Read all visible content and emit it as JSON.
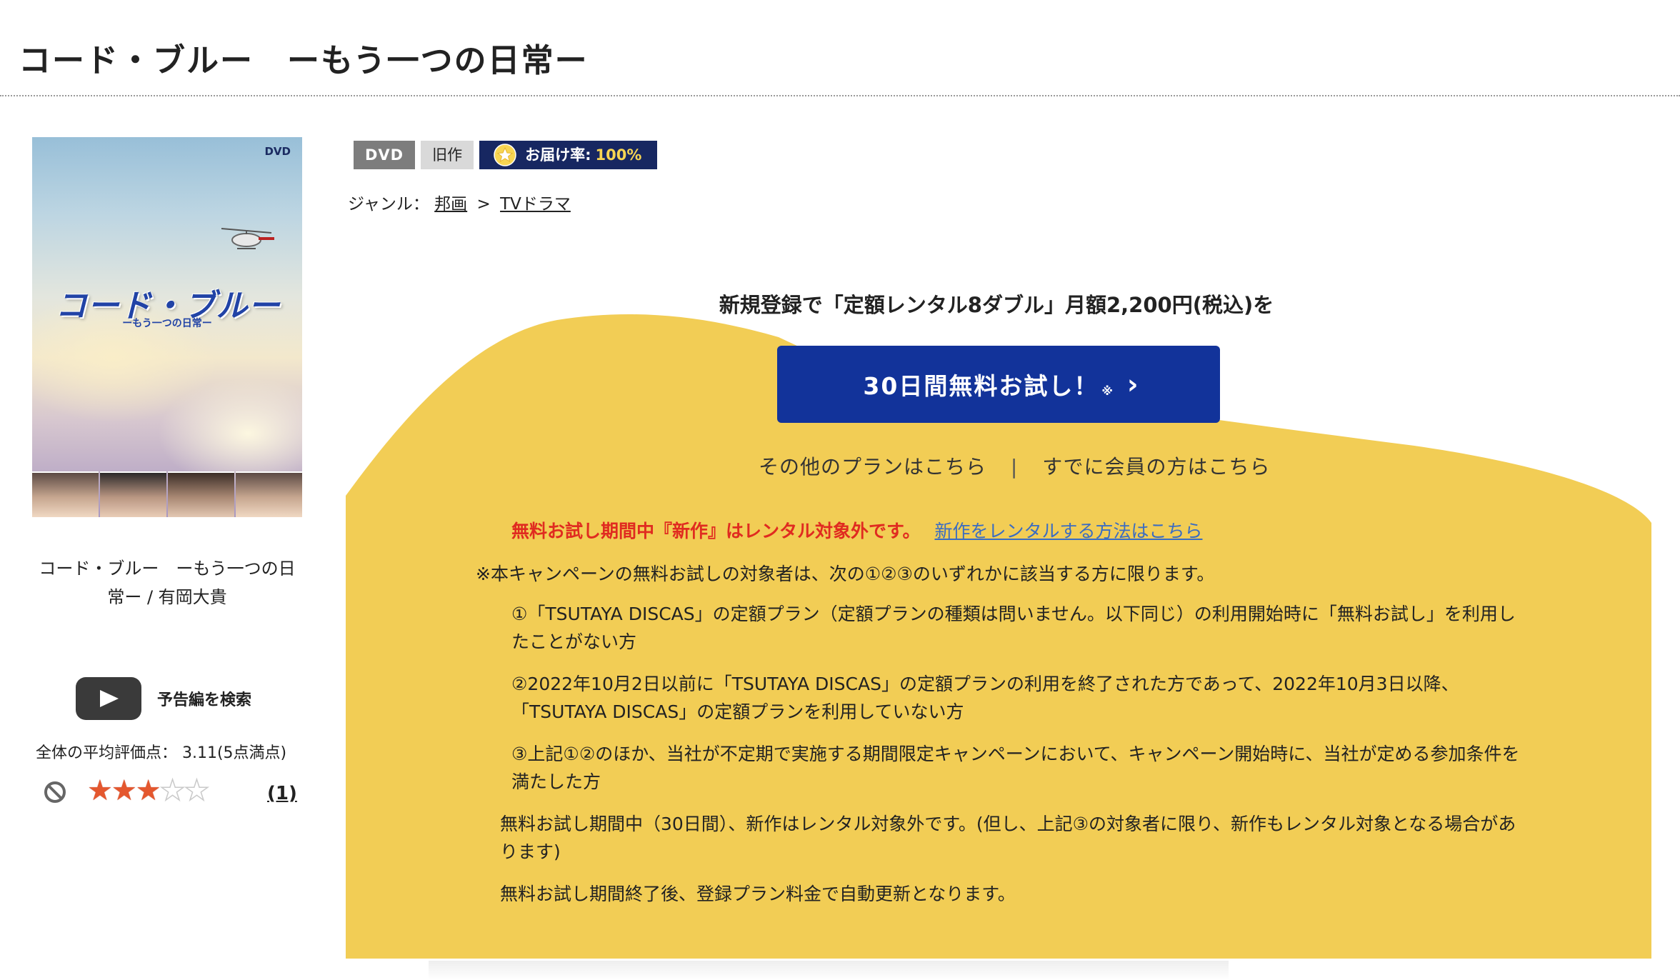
{
  "page": {
    "title": "コード・ブルー　ーもう一つの日常ー"
  },
  "cover": {
    "dvd_mark": "DVD",
    "logo_text": "コード・ブルー",
    "subtitle_text": "ーもう一つの日常ー"
  },
  "item": {
    "caption_line1": "コード・ブルー　ーもう一つの日",
    "caption_line2": "常ー / 有岡大貴",
    "trailer_label": "予告編を検索",
    "rating_text": "全体の平均評価点： 3.11(5点満点)",
    "rating_value": 3.11,
    "rating_stars_filled": 3,
    "rating_stars_total": 5,
    "review_count": "(1)"
  },
  "badges": {
    "format": "DVD",
    "release": "旧作",
    "delivery_label": "お届け率:",
    "delivery_rate": "100%"
  },
  "genre": {
    "label": "ジャンル：",
    "level1": "邦画",
    "separator": ">",
    "level2": "TVドラマ"
  },
  "promo": {
    "headline": "新規登録で「定額レンタル8ダブル」月額2,200円(税込)を",
    "cta_label": "30日間無料お試し！",
    "cta_note_mark": "※",
    "cta_chevron": "›",
    "other_plans": "その他のプランはこちら",
    "link_separator": "|",
    "member_login": "すでに会員の方はこちら",
    "warning_text": "無料お試し期間中『新作』はレンタル対象外です。",
    "warning_link": "新作をレンタルする方法はこちら",
    "conditions_intro": "※本キャンペーンの無料お試しの対象者は、次の①②③のいずれかに該当する方に限ります。",
    "condition_1": "①「TSUTAYA DISCAS」の定額プラン（定額プランの種類は問いません。以下同じ）の利用開始時に「無料お試し」を利用したことがない方",
    "condition_2": "②2022年10月2日以前に「TSUTAYA DISCAS」の定額プランの利用を終了された方であって、2022年10月3日以降、「TSUTAYA DISCAS」の定額プランを利用していない方",
    "condition_3": "③上記①②のほか、当社が不定期で実施する期間限定キャンペーンにおいて、キャンペーン開始時に、当社が定める参加条件を満たした方",
    "note_1": "無料お試し期間中（30日間）、新作はレンタル対象外です。(但し、上記③の対象者に限り、新作もレンタル対象となる場合があります)",
    "note_2": "無料お試し期間終了後、登録プラン料金で自動更新となります。"
  },
  "colors": {
    "promo_yellow": "#f2cd55",
    "cta_blue": "#12339a",
    "delivery_navy": "#172761",
    "warning_red": "#e02b20",
    "link_blue": "#3a6cc2",
    "star_filled": "#e4572e"
  },
  "icons": {
    "play": "play-icon",
    "block": "block-icon",
    "star": "star-icon",
    "chevron": "chevron-right-icon"
  }
}
